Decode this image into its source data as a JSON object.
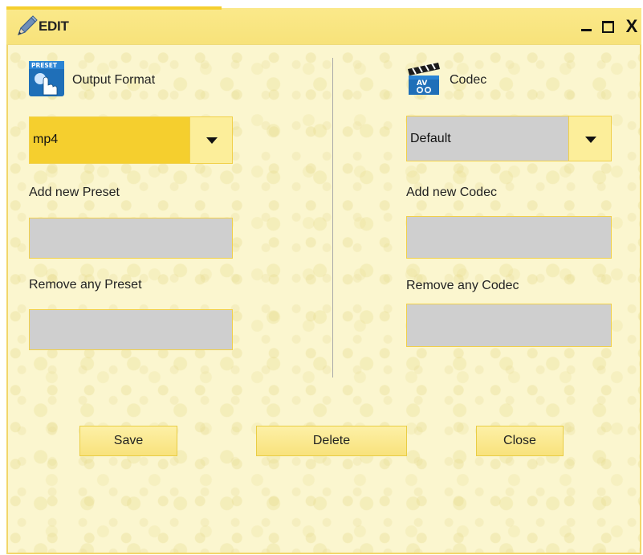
{
  "window": {
    "title": "EDIT",
    "icon": "pencil-icon",
    "controls": {
      "minimize_icon": "minimize-icon",
      "maximize_icon": "maximize-icon",
      "close_glyph": "X"
    }
  },
  "left": {
    "header_icon": "preset-icon",
    "header_icon_text": "PRESET",
    "header_label": "Output Format",
    "dropdown_value": "mp4",
    "add_label": "Add new Preset",
    "add_value": "",
    "remove_label": "Remove any  Preset",
    "remove_value": ""
  },
  "right": {
    "header_icon": "av-codec-icon",
    "header_icon_text": "AV",
    "header_label": "Codec",
    "dropdown_value": "Default",
    "add_label": "Add new Codec",
    "add_value": "",
    "remove_label": "Remove any Codec",
    "remove_value": ""
  },
  "buttons": {
    "save": "Save",
    "delete": "Delete",
    "close": "Close"
  },
  "colors": {
    "background": "#fbf6cf",
    "titlebar": "#f7e27a",
    "accent": "#f5cf2e",
    "field_gray": "#cfcfcf",
    "selected_dropdown": "#f5cf2e",
    "button": "#f8e27c"
  }
}
